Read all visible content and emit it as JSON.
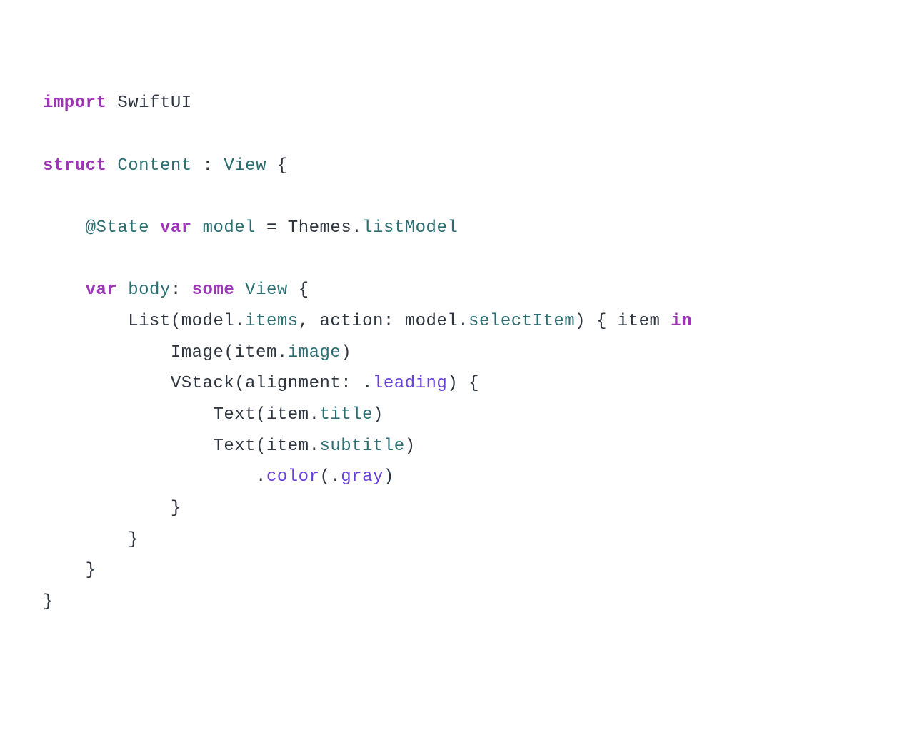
{
  "code": {
    "line1": {
      "kw": "import",
      "id": "SwiftUI"
    },
    "line3": {
      "kw1": "struct",
      "name": "Content",
      "colon": " : ",
      "type": "View",
      "brace": " {"
    },
    "line5": {
      "at": "@",
      "attr": "State",
      "kw": "var",
      "id": "model",
      "eq": " = ",
      "type": "Themes",
      "dot": ".",
      "prop": "listModel"
    },
    "line7": {
      "kw1": "var",
      "id": "body",
      "colon": ": ",
      "kw2": "some",
      "type": "View",
      "brace": " {"
    },
    "line8": {
      "fn": "List",
      "open": "(",
      "id": "model",
      "dot": ".",
      "prop": "items",
      "comma": ", ",
      "label": "action",
      "colon2": ": ",
      "id2": "model",
      "dot2": ".",
      "prop2": "selectItem",
      "close": ") { ",
      "param": "item",
      "kw": "in"
    },
    "line9": {
      "fn": "Image",
      "open": "(",
      "id": "item",
      "dot": ".",
      "prop": "image",
      "close": ")"
    },
    "line10": {
      "fn": "VStack",
      "open": "(",
      "label": "alignment",
      "colon": ": .",
      "prop": "leading",
      "close": ") {"
    },
    "line11": {
      "fn": "Text",
      "open": "(",
      "id": "item",
      "dot": ".",
      "prop": "title",
      "close": ")"
    },
    "line12": {
      "fn": "Text",
      "open": "(",
      "id": "item",
      "dot": ".",
      "prop": "subtitle",
      "close": ")"
    },
    "line13": {
      "dot": ".",
      "fn": "color",
      "open": "(.",
      "prop": "gray",
      "close": ")"
    },
    "line14": "}",
    "line15": "}",
    "line16": "}",
    "line17": "}"
  }
}
